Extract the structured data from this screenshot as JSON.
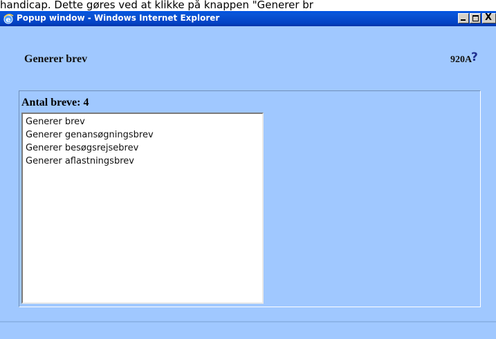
{
  "document": {
    "background_text": "handicap. Dette gøres ved at klikke på knappen \"Generer br"
  },
  "window": {
    "title": "Popup window - Windows Internet Explorer",
    "icon": "ie-logo-icon",
    "controls": {
      "minimize": "minimize-icon",
      "maximize": "maximize-icon",
      "close_glyph": "X"
    }
  },
  "page": {
    "heading": "Generer brev",
    "code": "920A",
    "help": "?"
  },
  "panel": {
    "label": "Antal breve: 4",
    "items": [
      "Generer brev",
      "Generer genansøgningsbrev",
      "Generer besøgsrejsebrev",
      "Generer aflastningsbrev"
    ]
  },
  "colors": {
    "page_background": "#a0c8ff",
    "titlebar": "#0054e3",
    "help_link": "#1f2f8f"
  }
}
